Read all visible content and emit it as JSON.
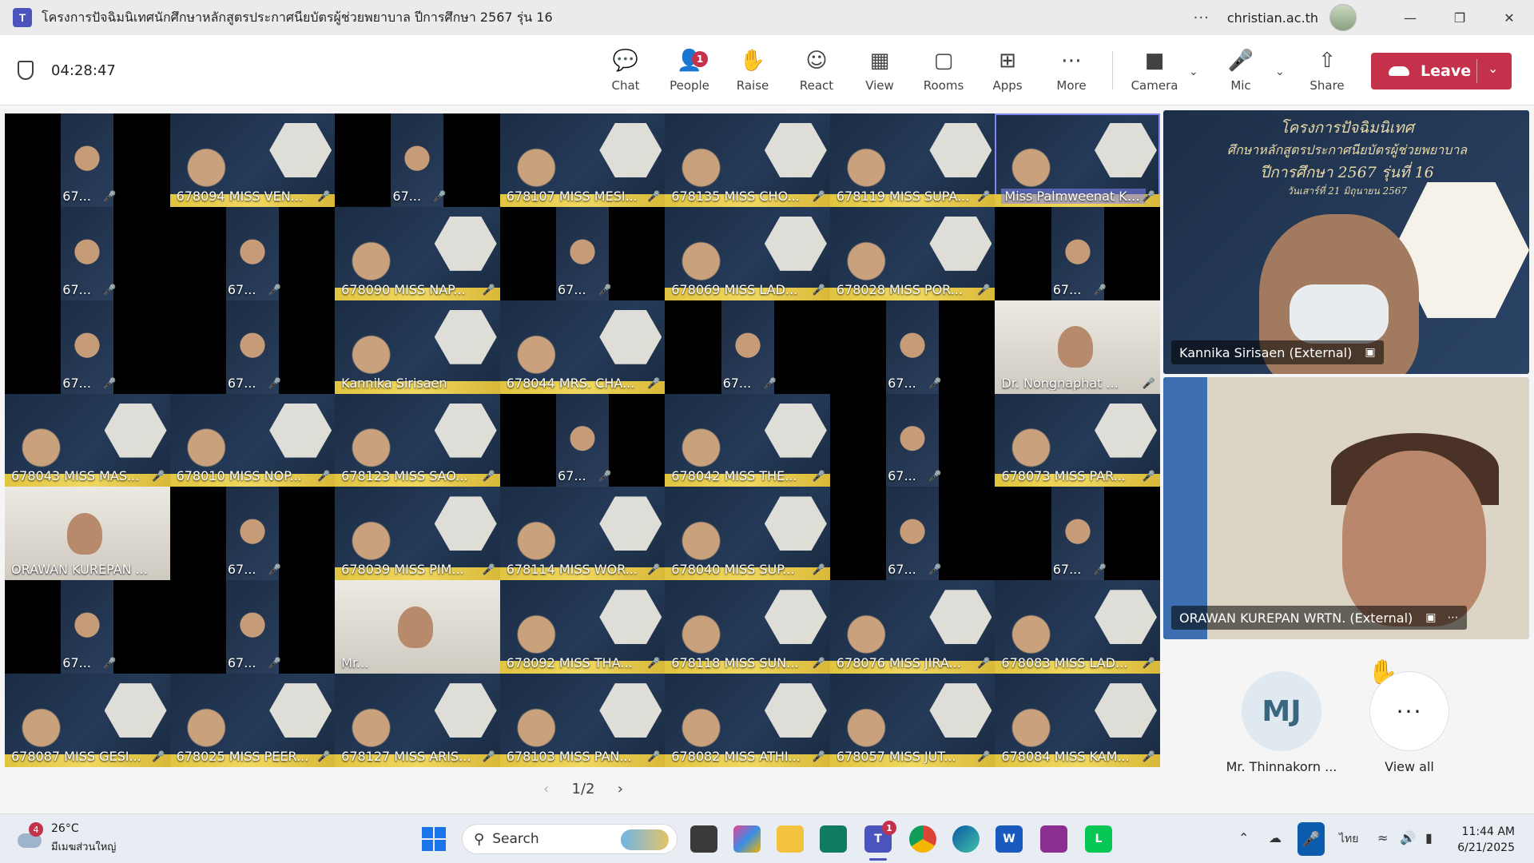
{
  "window": {
    "title": "โครงการปัจฉิมนิเทศนักศึกษาหลักสูตรประกาศนียบัตรผู้ช่วยพยาบาล ปีการศึกษา 2567 รุ่น 16",
    "more": "···",
    "account": "christian.ac.th",
    "minimize": "—",
    "restore": "❐",
    "close": "✕"
  },
  "toolbar": {
    "timer": "04:28:47",
    "buttons": [
      {
        "label": "Chat",
        "icon": "chat-icon"
      },
      {
        "label": "People",
        "icon": "people-icon",
        "badge": "1"
      },
      {
        "label": "Raise",
        "icon": "raise-hand-icon"
      },
      {
        "label": "React",
        "icon": "react-icon"
      },
      {
        "label": "View",
        "icon": "view-icon"
      },
      {
        "label": "Rooms",
        "icon": "rooms-icon"
      },
      {
        "label": "Apps",
        "icon": "apps-icon"
      },
      {
        "label": "More",
        "icon": "more-icon"
      },
      {
        "label": "Camera",
        "icon": "camera-icon"
      },
      {
        "label": "Mic",
        "icon": "mic-icon"
      },
      {
        "label": "Share",
        "icon": "share-icon"
      }
    ],
    "leave": "Leave",
    "leave_color": "#c4314b"
  },
  "grid": {
    "tiles": [
      {
        "name": "67...",
        "kind": "narrow"
      },
      {
        "name": "678094 MISS VEN...",
        "kind": "slide"
      },
      {
        "name": "67...",
        "kind": "narrow"
      },
      {
        "name": "678107 MISS MESI...",
        "kind": "slide"
      },
      {
        "name": "678135 MISS CHO...",
        "kind": "slide"
      },
      {
        "name": "678119 MISS SUPA...",
        "kind": "slide"
      },
      {
        "name": "Miss Palmweenat Ki...",
        "kind": "slide",
        "active": true
      },
      {
        "name": "67...",
        "kind": "narrow"
      },
      {
        "name": "67...",
        "kind": "narrow"
      },
      {
        "name": "678090 MISS NAP...",
        "kind": "slide"
      },
      {
        "name": "67...",
        "kind": "narrow"
      },
      {
        "name": "678069 MISS LAD...",
        "kind": "slide"
      },
      {
        "name": "678028 MISS POR...",
        "kind": "slide"
      },
      {
        "name": "67...",
        "kind": "narrow"
      },
      {
        "name": "67...",
        "kind": "narrow"
      },
      {
        "name": "67...",
        "kind": "narrow"
      },
      {
        "name": "Kannika  Sirisaen",
        "kind": "slide",
        "nomic": true
      },
      {
        "name": "678044 MRS. CHA...",
        "kind": "slide"
      },
      {
        "name": "67...",
        "kind": "narrow"
      },
      {
        "name": "67...",
        "kind": "narrow"
      },
      {
        "name": "Dr. Nongnaphat ...",
        "kind": "room"
      },
      {
        "name": "678043 MISS MAS...",
        "kind": "slide"
      },
      {
        "name": "678010 MISS NOP...",
        "kind": "slide"
      },
      {
        "name": "678123 MISS SAO...",
        "kind": "slide"
      },
      {
        "name": "67...",
        "kind": "narrow"
      },
      {
        "name": "678042 MISS THE...",
        "kind": "slide"
      },
      {
        "name": "67...",
        "kind": "narrow"
      },
      {
        "name": "678073 MISS PAR...",
        "kind": "slide"
      },
      {
        "name": "ORAWAN KUREPAN ...",
        "kind": "room",
        "nomic": true
      },
      {
        "name": "67...",
        "kind": "narrow"
      },
      {
        "name": "678039 MISS PIM...",
        "kind": "slide"
      },
      {
        "name": "678114 MISS WOR...",
        "kind": "slide"
      },
      {
        "name": "678040 MISS SUP...",
        "kind": "slide"
      },
      {
        "name": "67...",
        "kind": "narrow"
      },
      {
        "name": "67...",
        "kind": "narrow"
      },
      {
        "name": "67...",
        "kind": "narrow"
      },
      {
        "name": "67...",
        "kind": "narrow"
      },
      {
        "name": "Mr...",
        "kind": "room",
        "nomic": true
      },
      {
        "name": "678092 MISS THA...",
        "kind": "slide"
      },
      {
        "name": "678118 MISS SUN...",
        "kind": "slide"
      },
      {
        "name": "678076 MISS JIRA...",
        "kind": "slide"
      },
      {
        "name": "678083 MISS LAD...",
        "kind": "slide"
      },
      {
        "name": "678087 MISS GESI...",
        "kind": "slide"
      },
      {
        "name": "678025 MISS PEER...",
        "kind": "slide"
      },
      {
        "name": "678127 MISS ARIS...",
        "kind": "slide"
      },
      {
        "name": "678103 MISS PAN...",
        "kind": "slide"
      },
      {
        "name": "678082 MISS ATHI...",
        "kind": "slide"
      },
      {
        "name": "678057 MISS JUT...",
        "kind": "slide"
      },
      {
        "name": "678084 MISS KAM...",
        "kind": "slide"
      }
    ],
    "page": "1/2"
  },
  "right_panel": {
    "tile1": {
      "name": "Kannika Sirisaen (External)",
      "slide_lines": [
        "โครงการปัจฉิมนิเทศ",
        "ศึกษาหลักสูตรประกาศนียบัตรผู้ช่วยพยาบาล",
        "ปีการศึกษา 2567 รุ่นที่ 16",
        "วันเสาร์ที่ 21 มิถุนายน 2567"
      ]
    },
    "tile2": {
      "name": "ORAWAN KUREPAN WRTN. (External)"
    },
    "avatar": {
      "initials": "MJ",
      "name": "Mr. Thinnakorn ..."
    },
    "view_all": {
      "label": "View all",
      "icon": "···"
    }
  },
  "taskbar": {
    "weather_badge": "4",
    "temp": "26°C",
    "weather_desc": "มีเมฆส่วนใหญ่",
    "search": "Search",
    "teams_badge": "1",
    "lang": "ไทย",
    "time": "11:44 AM",
    "date": "6/21/2025"
  }
}
